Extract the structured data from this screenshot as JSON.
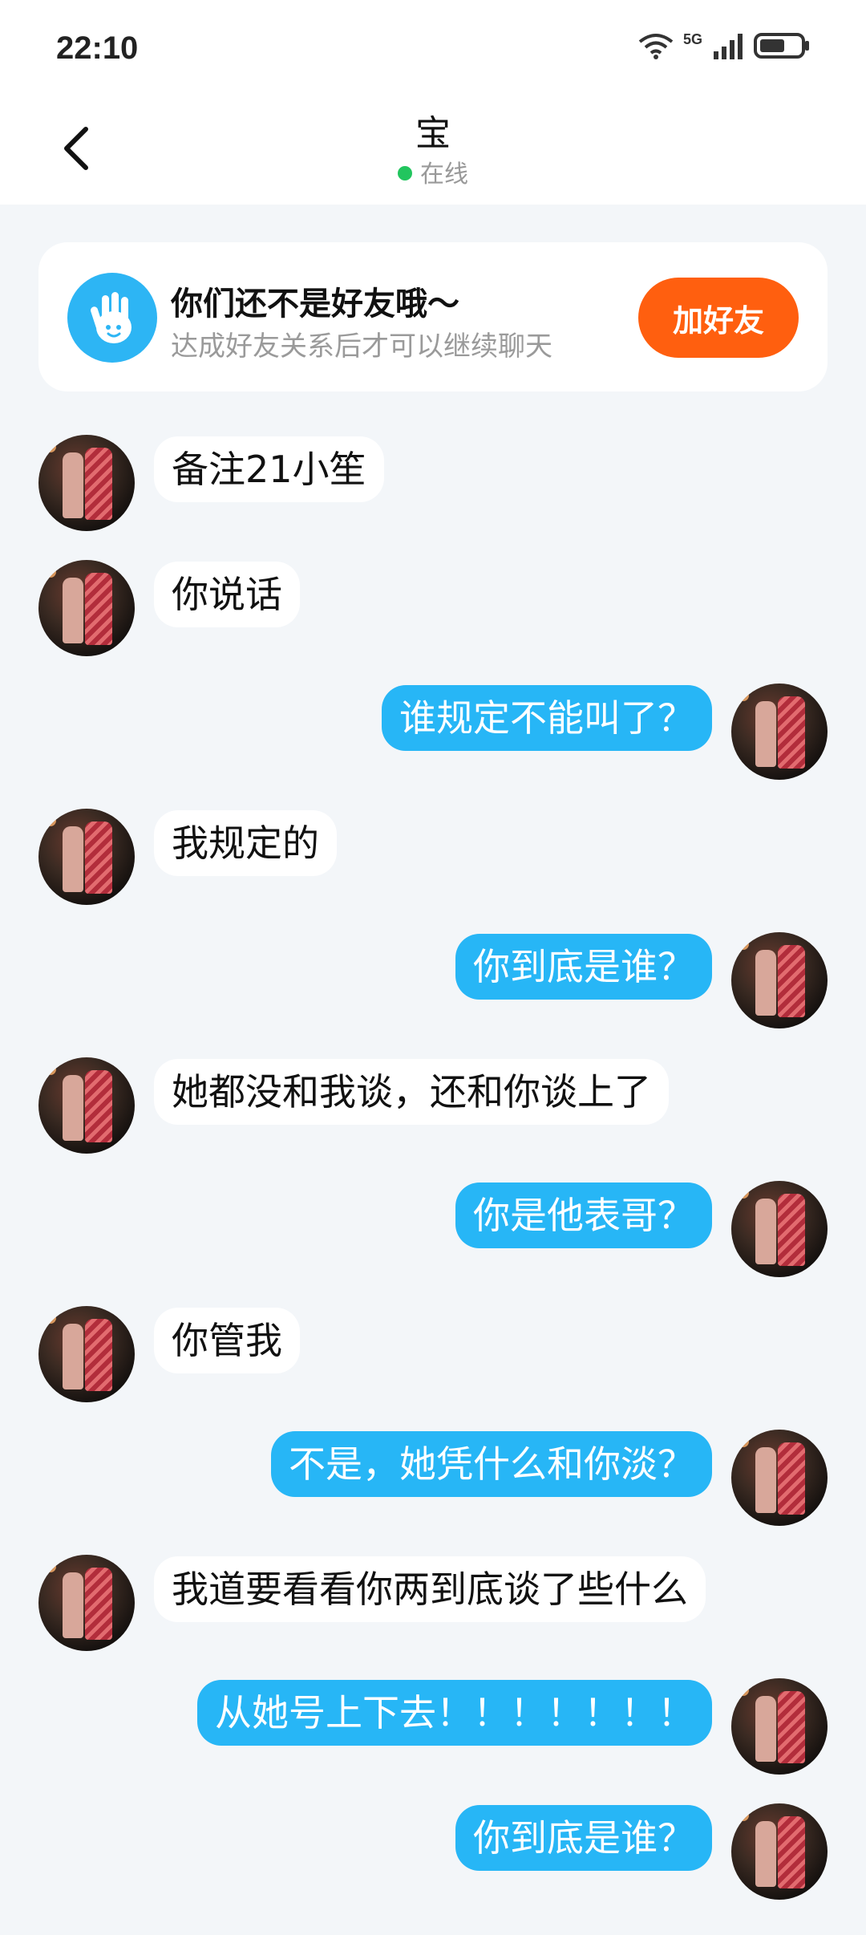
{
  "status_bar": {
    "time": "22:10",
    "network": "5G"
  },
  "header": {
    "title": "宝",
    "status": "在线"
  },
  "friend_card": {
    "title": "你们还不是好友哦～",
    "subtitle": "达成好友关系后才可以继续聊天",
    "button": "加好友"
  },
  "colors": {
    "accent_blue": "#27b6f6",
    "add_friend_orange": "#ff5f0f",
    "online_green": "#22c55e",
    "page_bg": "#f3f6f9"
  },
  "messages": [
    {
      "side": "in",
      "text": "备注21小笙"
    },
    {
      "side": "in",
      "text": "你说话"
    },
    {
      "side": "out",
      "text": "谁规定不能叫了？"
    },
    {
      "side": "in",
      "text": "我规定的"
    },
    {
      "side": "out",
      "text": "你到底是谁？"
    },
    {
      "side": "in",
      "text": "她都没和我谈，还和你谈上了"
    },
    {
      "side": "out",
      "text": "你是他表哥？"
    },
    {
      "side": "in",
      "text": "你管我"
    },
    {
      "side": "out",
      "text": "不是，她凭什么和你淡？"
    },
    {
      "side": "in",
      "text": "我道要看看你两到底谈了些什么"
    },
    {
      "side": "out",
      "text": "从她号上下去！！！！！！！"
    },
    {
      "side": "out",
      "text": "你到底是谁？"
    }
  ]
}
